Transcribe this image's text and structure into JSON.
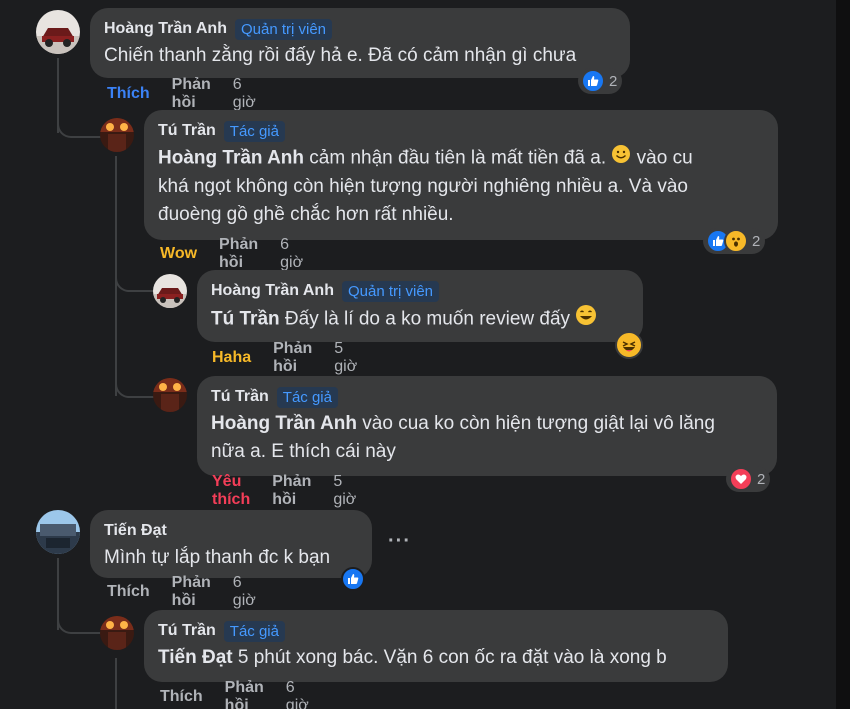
{
  "comments": [
    {
      "author": "Hoàng Trần Anh",
      "badge": "Quản trị viên",
      "text": "Chiến thanh zằng rồi đấy hả e. Đã có cảm nhận gì chưa",
      "actions": {
        "reaction": "Thích",
        "reply": "Phản hồi",
        "time": "6 giờ"
      },
      "reaction_count": "2",
      "reaction_icons": [
        "like-icon"
      ]
    },
    {
      "author": "Tú Trần",
      "badge": "Tác giả",
      "mention": "Hoàng Trần Anh",
      "text_line1": " cảm nhận đầu tiên là mất tiền đã a. ",
      "text_line1b": " vào cu",
      "text_line2": "khá ngọt không còn hiện tượng người nghiêng nhiều a. Và vào",
      "text_line3": "đuoèng gồ ghề chắc hơn rất nhiều.",
      "actions": {
        "reaction": "Wow",
        "reply": "Phản hồi",
        "time": "6 giờ"
      },
      "reaction_count": "2",
      "reaction_icons": [
        "like-icon",
        "wow-icon"
      ]
    },
    {
      "author": "Hoàng Trần Anh",
      "badge": "Quản trị viên",
      "mention": "Tú Trần",
      "text": " Đấy là lí do a ko muốn review đấy ",
      "actions": {
        "reaction": "Haha",
        "reply": "Phản hồi",
        "time": "5 giờ"
      },
      "reaction_icons": [
        "haha-icon"
      ]
    },
    {
      "author": "Tú Trần",
      "badge": "Tác giả",
      "mention": "Hoàng Trần Anh",
      "text_line1": " vào cua ko còn hiện tượng giật lại vô lăng",
      "text_line2": "nữa a. E thích cái này",
      "actions": {
        "reaction": "Yêu thích",
        "reply": "Phản hồi",
        "time": "5 giờ"
      },
      "reaction_count": "2",
      "reaction_icons": [
        "love-icon"
      ]
    },
    {
      "author": "Tiến Đạt",
      "text": "Mình tự lắp thanh đc k bạn",
      "more": "···",
      "actions": {
        "reaction": "Thích",
        "reply": "Phản hồi",
        "time": "6 giờ"
      },
      "reaction_icons": [
        "like-icon"
      ]
    },
    {
      "author": "Tú Trần",
      "badge": "Tác giả",
      "mention": "Tiến Đạt",
      "text": " 5 phút xong bác. Vặn 6 con ốc ra đặt vào là xong b",
      "actions": {
        "reaction": "Thích",
        "reply": "Phản hồi",
        "time": "6 giờ"
      }
    }
  ],
  "colors": {
    "background": "#1c1d1f",
    "bubble": "#3a3b3c",
    "text": "#e4e6eb",
    "muted": "#b0b3b8",
    "badge_text": "#4599ff",
    "badge_bg": "#263951",
    "like": "#3b82f6",
    "wow": "#f7b928",
    "love": "#f33e58"
  }
}
